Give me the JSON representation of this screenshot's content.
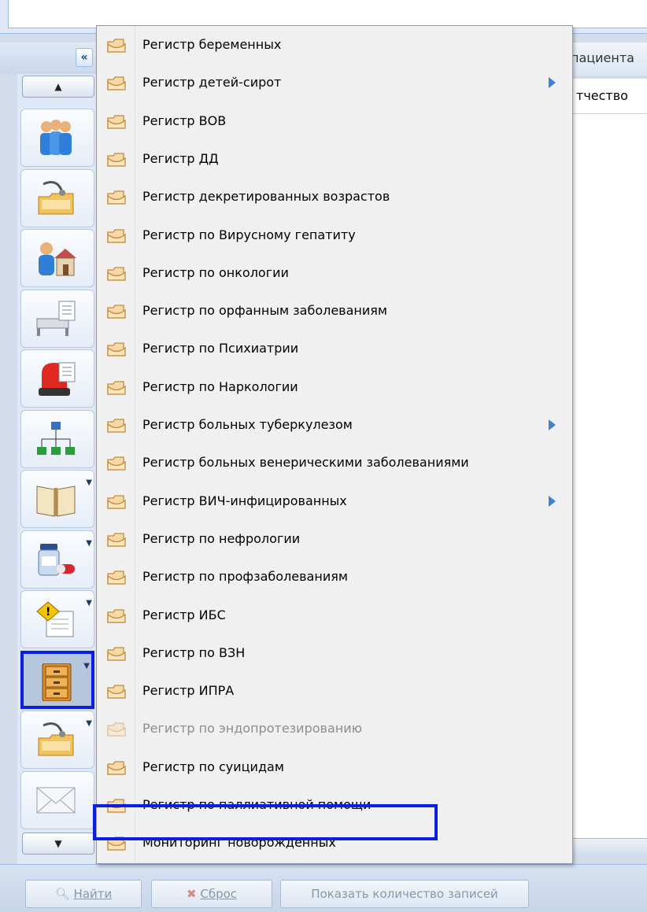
{
  "grid": {
    "header_partial": "пациента",
    "column_partial": "тчество"
  },
  "toolbar": {
    "collapse_label": "«",
    "scroll_up_label": "▲",
    "scroll_down_label": "▼",
    "buttons": [
      {
        "icon": "patients-group-icon",
        "has_dropdown": false,
        "selected": false
      },
      {
        "icon": "stethoscope-folder-icon",
        "has_dropdown": false,
        "selected": false
      },
      {
        "icon": "home-visit-icon",
        "has_dropdown": false,
        "selected": false
      },
      {
        "icon": "hospital-bed-icon",
        "has_dropdown": false,
        "selected": false
      },
      {
        "icon": "emergency-siren-icon",
        "has_dropdown": false,
        "selected": false
      },
      {
        "icon": "structure-tree-icon",
        "has_dropdown": false,
        "selected": false
      },
      {
        "icon": "book-icon",
        "has_dropdown": true,
        "selected": false
      },
      {
        "icon": "medicine-pills-icon",
        "has_dropdown": true,
        "selected": false
      },
      {
        "icon": "warning-document-icon",
        "has_dropdown": true,
        "selected": false
      },
      {
        "icon": "file-cabinet-icon",
        "has_dropdown": true,
        "selected": true
      },
      {
        "icon": "stethoscope-folder-icon",
        "has_dropdown": true,
        "selected": false
      },
      {
        "icon": "envelope-icon",
        "has_dropdown": false,
        "selected": false
      }
    ]
  },
  "menu": {
    "items": [
      {
        "label": "Регистр беременных",
        "submenu": false,
        "disabled": false
      },
      {
        "label": "Регистр детей-сирот",
        "submenu": true,
        "disabled": false
      },
      {
        "label": "Регистр ВОВ",
        "submenu": false,
        "disabled": false
      },
      {
        "label": "Регистр ДД",
        "submenu": false,
        "disabled": false
      },
      {
        "label": "Регистр декретированных возрастов",
        "submenu": false,
        "disabled": false
      },
      {
        "label": "Регистр по Вирусному гепатиту",
        "submenu": false,
        "disabled": false
      },
      {
        "label": "Регистр по онкологии",
        "submenu": false,
        "disabled": false
      },
      {
        "label": "Регистр по орфанным заболеваниям",
        "submenu": false,
        "disabled": false
      },
      {
        "label": "Регистр по Психиатрии",
        "submenu": false,
        "disabled": false
      },
      {
        "label": "Регистр по Наркологии",
        "submenu": false,
        "disabled": false
      },
      {
        "label": "Регистр больных туберкулезом",
        "submenu": true,
        "disabled": false
      },
      {
        "label": "Регистр больных венерическими заболеваниями",
        "submenu": false,
        "disabled": false
      },
      {
        "label": "Регистр ВИЧ-инфицированных",
        "submenu": true,
        "disabled": false
      },
      {
        "label": "Регистр по нефрологии",
        "submenu": false,
        "disabled": false
      },
      {
        "label": "Регистр по профзаболеваниям",
        "submenu": false,
        "disabled": false
      },
      {
        "label": "Регистр ИБС",
        "submenu": false,
        "disabled": false
      },
      {
        "label": "Регистр по ВЗН",
        "submenu": false,
        "disabled": false
      },
      {
        "label": "Регистр ИПРА",
        "submenu": false,
        "disabled": false
      },
      {
        "label": "Регистр по эндопротезированию",
        "submenu": false,
        "disabled": true
      },
      {
        "label": "Регистр по суицидам",
        "submenu": false,
        "disabled": false
      },
      {
        "label": "Регистр по паллиативной помощи",
        "submenu": false,
        "disabled": false,
        "highlighted": true
      },
      {
        "label": "Мониторинг новорожденных",
        "submenu": false,
        "disabled": false
      }
    ]
  },
  "footer": {
    "find_label": "Найти",
    "reset_label": "Сброс",
    "count_label": "Показать количество записей"
  },
  "colors": {
    "highlight_border": "#0b1fe0",
    "submenu_arrow": "#3b82d6",
    "disabled_text": "#8d8d8d"
  }
}
